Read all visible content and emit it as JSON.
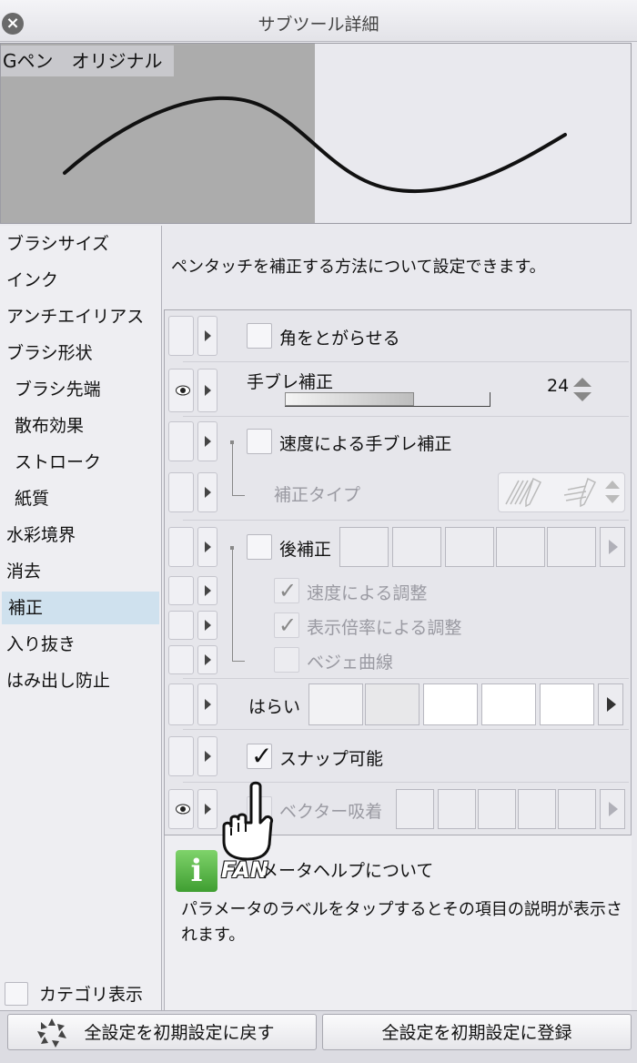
{
  "window": {
    "title": "サブツール詳細"
  },
  "preview": {
    "tool_name": "Gペン　オリジナル"
  },
  "categories": [
    {
      "label": "ブラシサイズ",
      "sub": false,
      "selected": false
    },
    {
      "label": "インク",
      "sub": false,
      "selected": false
    },
    {
      "label": "アンチエイリアス",
      "sub": false,
      "selected": false
    },
    {
      "label": "ブラシ形状",
      "sub": false,
      "selected": false
    },
    {
      "label": "ブラシ先端",
      "sub": true,
      "selected": false
    },
    {
      "label": "散布効果",
      "sub": true,
      "selected": false
    },
    {
      "label": "ストローク",
      "sub": true,
      "selected": false
    },
    {
      "label": "紙質",
      "sub": true,
      "selected": false
    },
    {
      "label": "水彩境界",
      "sub": false,
      "selected": false
    },
    {
      "label": "消去",
      "sub": false,
      "selected": false
    },
    {
      "label": "補正",
      "sub": false,
      "selected": true
    },
    {
      "label": "入り抜き",
      "sub": false,
      "selected": false
    },
    {
      "label": "はみ出し防止",
      "sub": false,
      "selected": false
    }
  ],
  "category_display_label": "カテゴリ表示",
  "description": "ペンタッチを補正する方法について設定できます。",
  "props": {
    "sharpen_corners": "角をとがらせる",
    "stabilization": {
      "label": "手ブレ補正",
      "value": "24",
      "level": 0.63
    },
    "speed_stabilization": "速度による手ブレ補正",
    "correction_type": "補正タイプ",
    "post_correction": "後補正",
    "speed_adjust": "速度による調整",
    "zoom_adjust": "表示倍率による調整",
    "bezier": "ベジェ曲線",
    "harai": "はらい",
    "snap": "スナップ可能",
    "vector_snap": "ベクター吸着"
  },
  "help": {
    "icon_glyph": "i",
    "fan_mark": "FAN",
    "title": "メータヘルプについて",
    "text": "パラメータのラベルをタップするとその項目の説明が表示されます。"
  },
  "buttons": {
    "reset": "全設定を初期設定に戻す",
    "register": "全設定を初期設定に登録"
  }
}
